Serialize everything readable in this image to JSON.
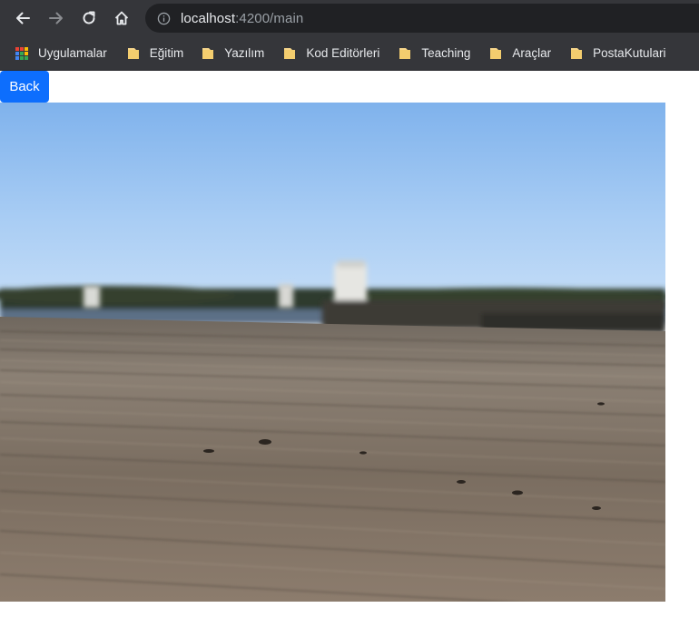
{
  "browser": {
    "url_host": "localhost",
    "url_path": ":4200/main",
    "bookmarks": [
      {
        "label": "Uygulamalar",
        "icon": "apps-grid-icon"
      },
      {
        "label": "Eğitim",
        "icon": "folder-icon"
      },
      {
        "label": "Yazılım",
        "icon": "folder-icon"
      },
      {
        "label": "Kod Editörleri",
        "icon": "folder-icon"
      },
      {
        "label": "Teaching",
        "icon": "folder-icon"
      },
      {
        "label": "Araçlar",
        "icon": "folder-icon"
      },
      {
        "label": "PostaKutulari",
        "icon": "folder-icon"
      }
    ]
  },
  "page": {
    "back_label": "Back",
    "back_color": "#0d6efd",
    "image_subject": "boardwalk-pier-photo"
  }
}
